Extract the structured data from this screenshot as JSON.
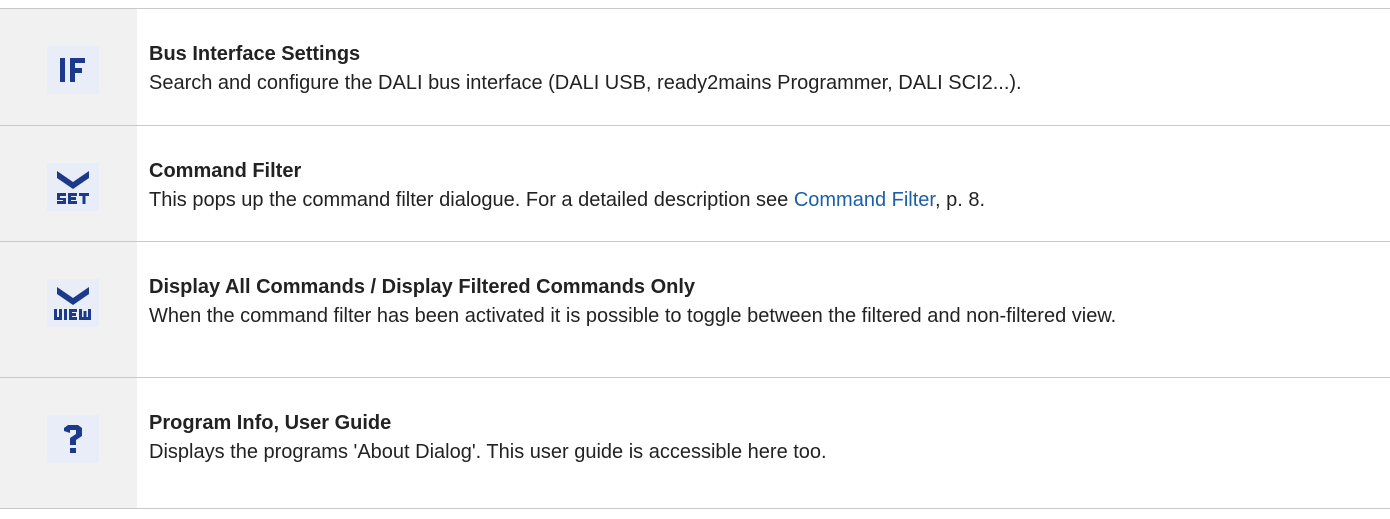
{
  "rows": [
    {
      "icon": "if-icon",
      "icon_glyph": "IF",
      "title": "Bus Interface Settings",
      "description": "Search and configure the DALI bus interface (DALI USB, ready2mains Programmer, DALI SCI2...)."
    },
    {
      "icon": "set-filter-icon",
      "icon_glyph": "SET",
      "title": "Command Filter",
      "description_before": "This pops up the command filter dialogue. For a detailed description see ",
      "link_text": "Command Filter",
      "description_after": ", p. 8."
    },
    {
      "icon": "view-filter-icon",
      "icon_glyph": "VIEW",
      "title": "Display All Commands / Display Filtered Commands Only",
      "description": "When the command filter has been activated it is possible to toggle between the filtered and non-filtered view."
    },
    {
      "icon": "question-icon",
      "icon_glyph": "?",
      "title": "Program Info, User Guide",
      "description": "Displays the programs 'About Dialog'. This user guide is accessible here too."
    }
  ],
  "colors": {
    "icon_blue": "#1c3a8c",
    "link": "#1d5fa6",
    "icon_tile_bg": "#e8edf7",
    "icon_column_bg": "#f1f1f1",
    "text": "#222222",
    "border": "#c8c8c8"
  }
}
